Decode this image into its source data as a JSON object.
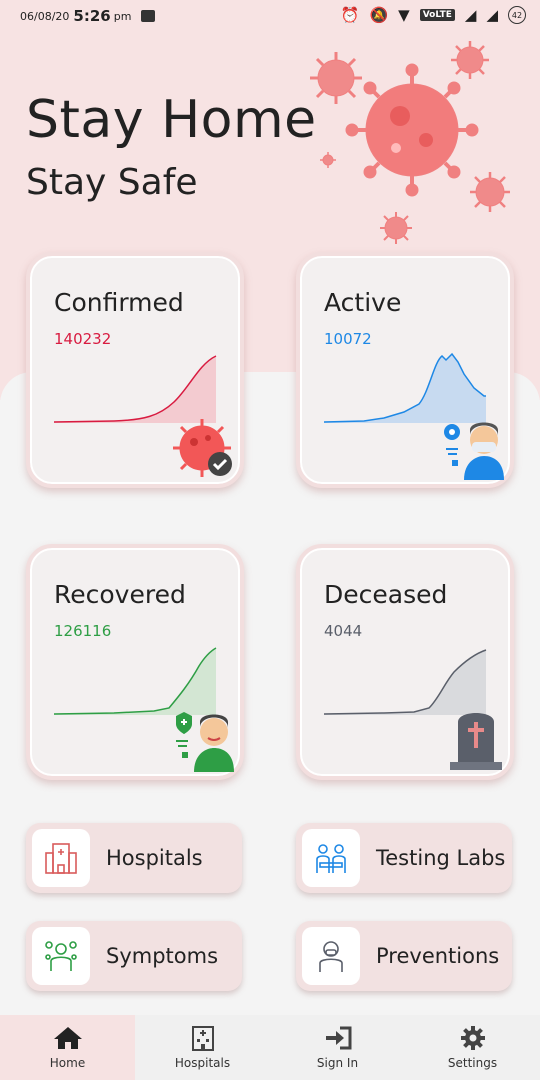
{
  "status_bar": {
    "date": "06/08/20",
    "time": "5:26",
    "ampm": "pm",
    "battery": "42",
    "network": "VoLTE"
  },
  "header": {
    "title": "Stay Home",
    "subtitle": "Stay Safe"
  },
  "stats": {
    "confirmed": {
      "label": "Confirmed",
      "value": "140232",
      "color": "#d81b40",
      "fill": "#f3cbd0"
    },
    "active": {
      "label": "Active",
      "value": "10072",
      "color": "#1e88e5",
      "fill": "#c7daf0"
    },
    "recovered": {
      "label": "Recovered",
      "value": "126116",
      "color": "#2e9e45",
      "fill": "#d3e6d3"
    },
    "deceased": {
      "label": "Deceased",
      "value": "4044",
      "color": "#5a5f6a",
      "fill": "#d9dadd"
    }
  },
  "links": {
    "hospitals": "Hospitals",
    "testing_labs": "Testing Labs",
    "symptoms": "Symptoms",
    "preventions": "Preventions"
  },
  "nav": {
    "home": "Home",
    "hospitals": "Hospitals",
    "sign_in": "Sign In",
    "settings": "Settings"
  }
}
